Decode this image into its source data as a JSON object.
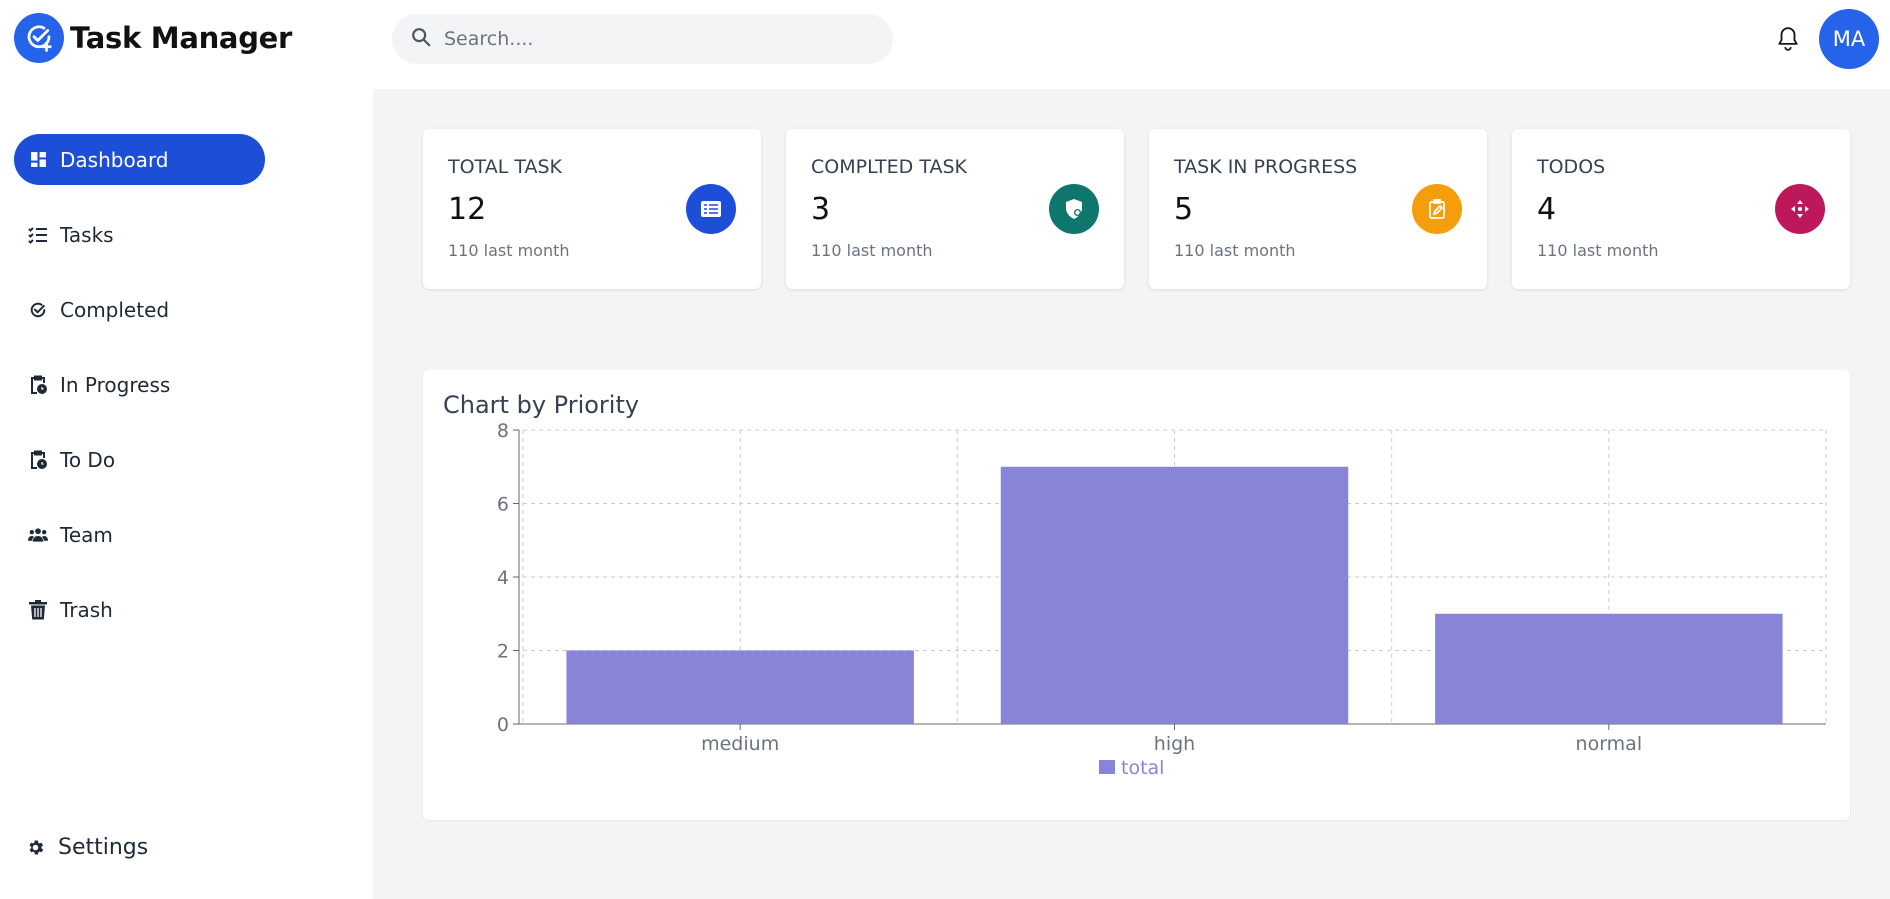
{
  "app": {
    "title": "Task Manager"
  },
  "search": {
    "placeholder": "Search...."
  },
  "user": {
    "initials": "MA"
  },
  "sidebar": {
    "items": [
      {
        "label": "Dashboard",
        "icon": "dashboard-icon",
        "active": true
      },
      {
        "label": "Tasks",
        "icon": "list-icon"
      },
      {
        "label": "Completed",
        "icon": "check-circle-icon"
      },
      {
        "label": "In Progress",
        "icon": "clipboard-clock-icon"
      },
      {
        "label": "To Do",
        "icon": "clipboard-clock-icon"
      },
      {
        "label": "Team",
        "icon": "users-icon"
      },
      {
        "label": "Trash",
        "icon": "trash-icon"
      }
    ],
    "settings_label": "Settings"
  },
  "stats": [
    {
      "title": "TOTAL TASK",
      "value": "12",
      "sub": "110 last month",
      "color": "#1d4ed8",
      "icon": "list-card-icon"
    },
    {
      "title": "COMPLTED TASK",
      "value": "3",
      "sub": "110 last month",
      "color": "#0f766e",
      "icon": "shield-icon"
    },
    {
      "title": "TASK IN PROGRESS",
      "value": "5",
      "sub": "110 last month",
      "color": "#f59e0b",
      "icon": "clipboard-edit-icon"
    },
    {
      "title": "TODOS",
      "value": "4",
      "sub": "110 last month",
      "color": "#be185d",
      "icon": "arrows-icon"
    }
  ],
  "chart_data": {
    "type": "bar",
    "title": "Chart by Priority",
    "categories": [
      "medium",
      "high",
      "normal"
    ],
    "series": [
      {
        "name": "total",
        "values": [
          2,
          7,
          3
        ],
        "color": "#8884d8"
      }
    ],
    "ylim": [
      0,
      8
    ],
    "yticks": [
      0,
      2,
      4,
      6,
      8
    ],
    "grid": true,
    "legend": "bottom"
  }
}
